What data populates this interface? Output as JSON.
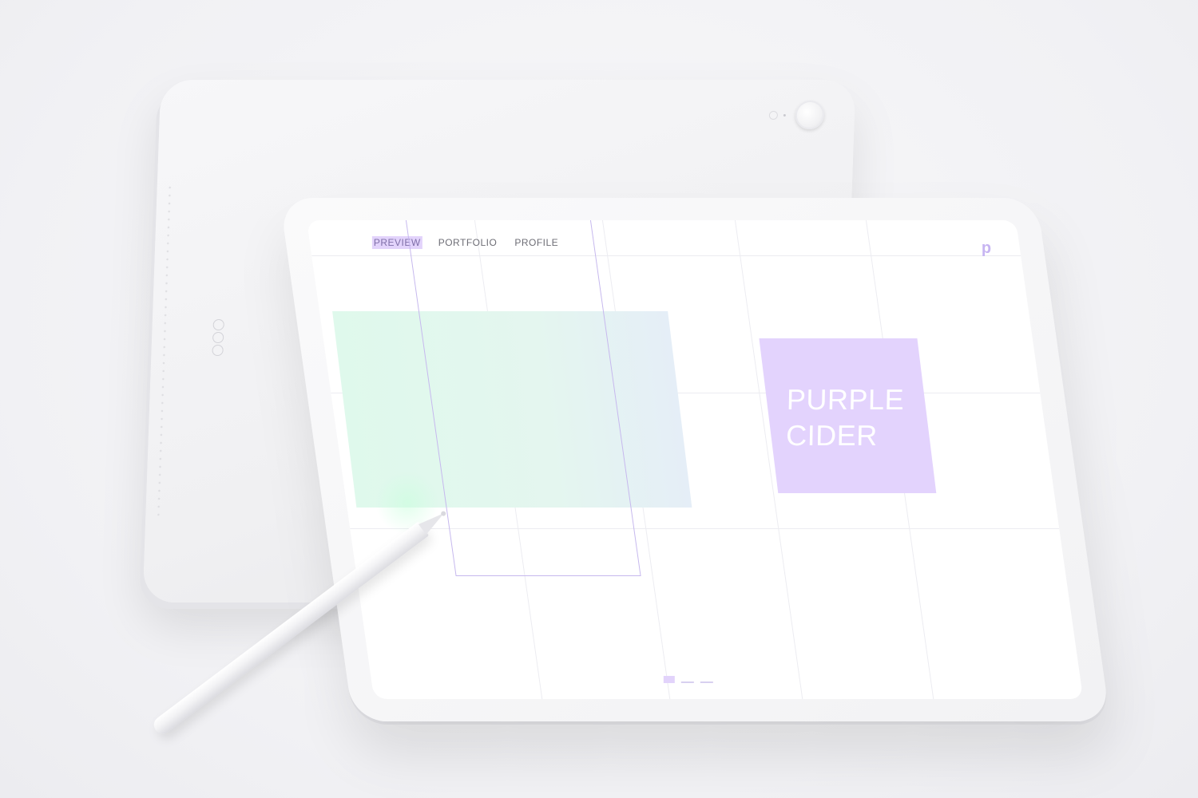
{
  "nav": {
    "items": [
      {
        "label": "PREVIEW",
        "active": true
      },
      {
        "label": "PORTFOLIO",
        "active": false
      },
      {
        "label": "PROFILE",
        "active": false
      }
    ]
  },
  "brand": {
    "logo": "p",
    "title_line1": "PURPLE",
    "title_line2": "CIDER"
  },
  "colors": {
    "accent": "#e2d3fb",
    "mint": "#dff9ec",
    "outline": "#c6b8ee"
  },
  "pager": {
    "count": 3,
    "active_index": 0
  },
  "icons": {
    "back_camera": "camera-icon",
    "pencil": "pencil-icon",
    "connector": "smart-connector-icon"
  }
}
